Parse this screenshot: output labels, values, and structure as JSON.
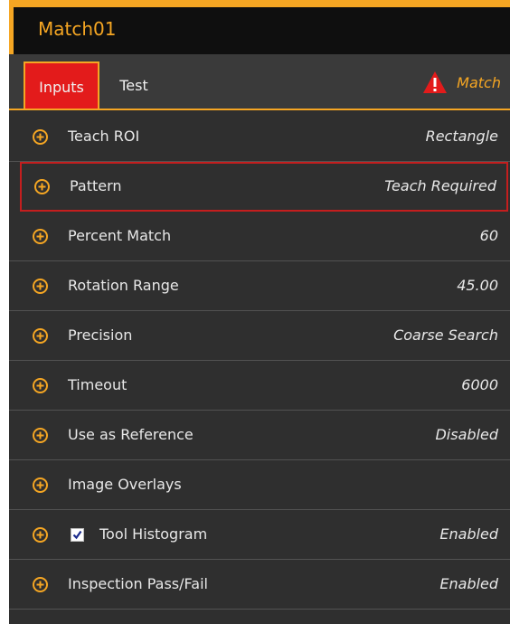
{
  "window": {
    "title": "Match01"
  },
  "tabs": [
    {
      "label": "Inputs",
      "active": true
    },
    {
      "label": "Test",
      "active": false
    }
  ],
  "status": {
    "label": "Match",
    "icon": "warning-icon",
    "color": "#f5a623"
  },
  "rows": [
    {
      "label": "Teach ROI",
      "value": "Rectangle",
      "icon": "expand-plus-icon"
    },
    {
      "label": "Pattern",
      "value": "Teach Required",
      "icon": "expand-plus-icon",
      "highlighted": true
    },
    {
      "label": "Percent Match",
      "value": "60",
      "icon": "expand-plus-icon"
    },
    {
      "label": "Rotation Range",
      "value": "45.00",
      "icon": "expand-plus-icon"
    },
    {
      "label": "Precision",
      "value": "Coarse Search",
      "icon": "expand-plus-icon"
    },
    {
      "label": "Timeout",
      "value": "6000",
      "icon": "expand-plus-icon"
    },
    {
      "label": "Use as Reference",
      "value": "Disabled",
      "icon": "expand-plus-icon"
    },
    {
      "label": "Image Overlays",
      "value": "",
      "icon": "expand-plus-icon"
    },
    {
      "label": "Tool Histogram",
      "value": "Enabled",
      "icon": "expand-plus-icon",
      "checked": true
    },
    {
      "label": "Inspection Pass/Fail",
      "value": "Enabled",
      "icon": "expand-plus-icon"
    }
  ],
  "colors": {
    "accent": "#f5a623",
    "active_tab": "#e31b1b",
    "highlight_border": "#c41e1e",
    "panel_bg": "#2f2f2f"
  }
}
